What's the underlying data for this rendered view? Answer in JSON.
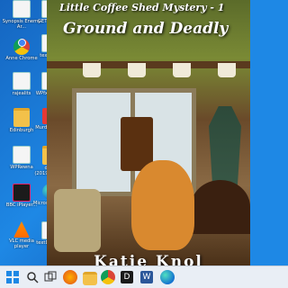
{
  "desktop": {
    "icons": [
      {
        "label": "Synopsis Enemy Ar..."
      },
      {
        "label": "GET-FIT-P..."
      },
      {
        "label": "Anne Chrome"
      },
      {
        "label": "textDoc1"
      },
      {
        "label": "Anne (Katie Knol) - C..."
      },
      {
        "label": "rajealits"
      },
      {
        "label": "WPfxIesffe..."
      },
      {
        "label": "Diario_Cc..."
      },
      {
        "label": "Edinburgh"
      },
      {
        "label": "MurderMys..."
      },
      {
        "label": "WPRewna"
      },
      {
        "label": "deep (2019_07_2..."
      },
      {
        "label": "BBC iPlayer..."
      },
      {
        "label": "Microsoft Edge"
      },
      {
        "label": "VLC media player"
      },
      {
        "label": "textDo2se..."
      }
    ]
  },
  "book": {
    "series": "Little Coffee Shed Mystery - 1",
    "title": "Ground and Deadly",
    "author": "Katie Knol"
  },
  "taskbar": {
    "items": [
      {
        "name": "windows-start-icon"
      },
      {
        "name": "search-icon"
      },
      {
        "name": "task-view-icon"
      },
      {
        "name": "firefox-icon"
      },
      {
        "name": "file-explorer-icon"
      },
      {
        "name": "chrome-icon"
      },
      {
        "name": "app-d-icon"
      },
      {
        "name": "word-icon"
      },
      {
        "name": "edge-icon"
      }
    ]
  }
}
